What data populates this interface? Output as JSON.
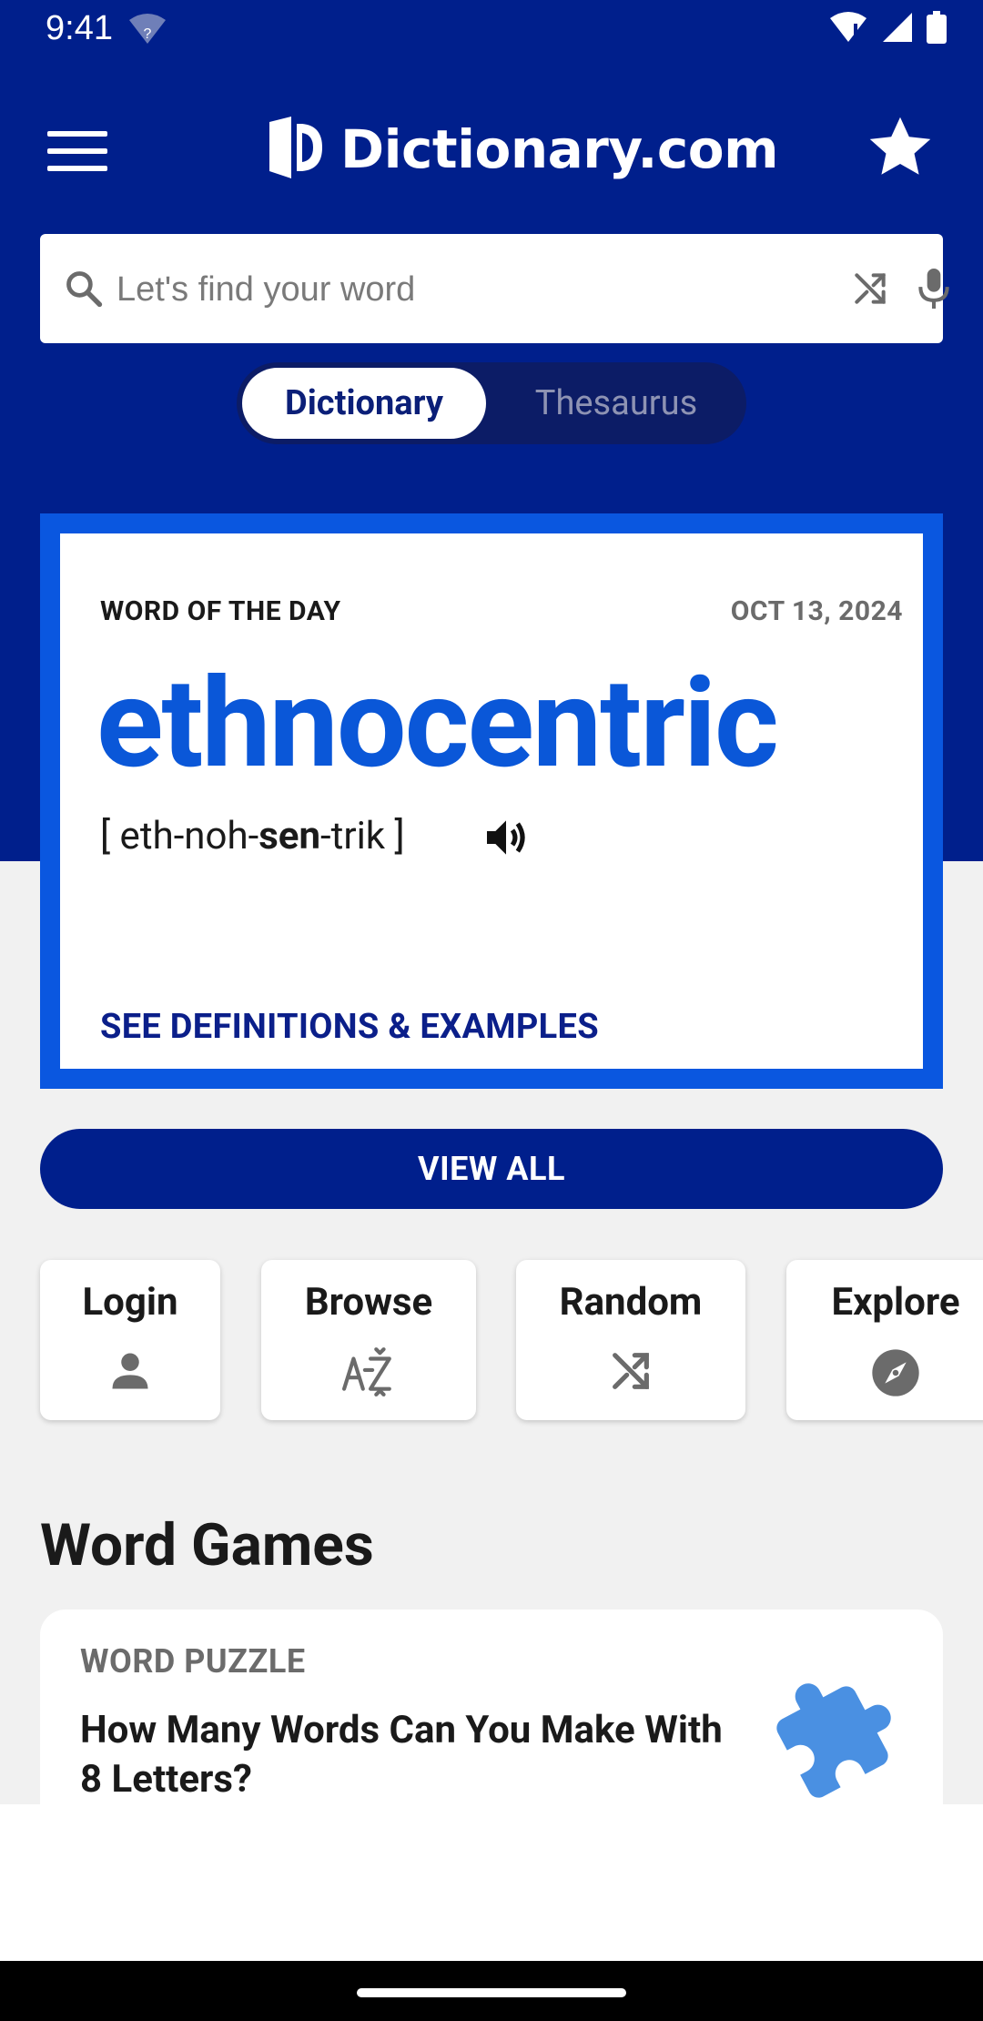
{
  "status_bar": {
    "time": "9:41"
  },
  "app_bar": {
    "brand": "Dictionary.com"
  },
  "search": {
    "placeholder": "Let's find your word"
  },
  "toggle": {
    "dictionary": "Dictionary",
    "thesaurus": "Thesaurus",
    "selected": "Dictionary"
  },
  "word_of_the_day": {
    "label": "WORD OF THE DAY",
    "date": "OCT 13, 2024",
    "word": "ethnocentric",
    "pron_open": "[ eth-noh-",
    "pron_stress": "sen",
    "pron_close": "-trik  ]",
    "link": "SEE DEFINITIONS & EXAMPLES"
  },
  "view_all": "VIEW ALL",
  "quick_links": [
    {
      "label": "Login",
      "icon": "person-icon"
    },
    {
      "label": "Browse",
      "icon": "a-z-sort-icon"
    },
    {
      "label": "Random",
      "icon": "shuffle-icon"
    },
    {
      "label": "Explore",
      "icon": "compass-icon"
    }
  ],
  "word_games": {
    "title": "Word Games",
    "card": {
      "category": "WORD PUZZLE",
      "title": "How Many Words Can You Make With 8 Letters?",
      "icon": "puzzle-piece-icon"
    }
  },
  "colors": {
    "primary": "#001f8c",
    "accent": "#0a57e0",
    "word": "#0a57d8",
    "puzzle": "#4a90e2"
  }
}
